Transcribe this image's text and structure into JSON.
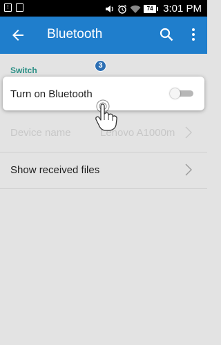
{
  "status_bar": {
    "battery": "74",
    "time": "3:01",
    "time_suffix": "PM"
  },
  "app_bar": {
    "title": "Bluetooth",
    "back_icon": "arrow-left-icon",
    "search_icon": "search-icon",
    "more_icon": "more-vert-icon"
  },
  "section": {
    "label": "Switch"
  },
  "step_badge": "3",
  "settings": {
    "bluetooth_toggle": {
      "label": "Turn on Bluetooth",
      "enabled": false
    },
    "device_name": {
      "label": "Device name",
      "value": "Lenovo A1000m"
    },
    "received_files": {
      "label": "Show received files"
    }
  },
  "colors": {
    "app_bar": "#1f7ecc",
    "section_label": "#2a8f85",
    "step_badge": "#2d6fb3"
  }
}
